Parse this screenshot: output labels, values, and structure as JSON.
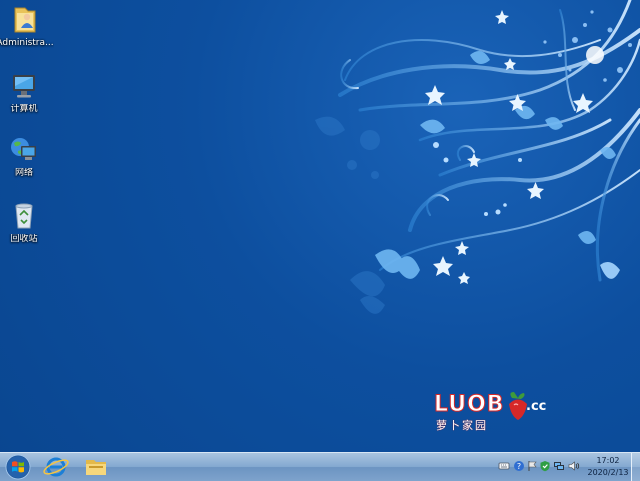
{
  "desktop": {
    "icons": [
      {
        "label": "Administra...",
        "icon": "user-folder-icon"
      },
      {
        "label": "计算机",
        "icon": "computer-icon"
      },
      {
        "label": "网络",
        "icon": "network-icon"
      },
      {
        "label": "回收站",
        "icon": "recycle-bin-icon"
      }
    ]
  },
  "wallpaper": {
    "logo_word": "LUOB",
    "logo_tld": ".cc",
    "logo_cn": "萝卜家园"
  },
  "taskbar": {
    "pinned": [
      {
        "name": "internet-explorer",
        "icon": "internet-explorer-icon"
      },
      {
        "name": "file-explorer",
        "icon": "folder-icon"
      }
    ],
    "tray": {
      "icons": [
        "keyboard-icon",
        "help-icon",
        "flag-icon",
        "shield-icon",
        "network-icon",
        "volume-icon"
      ]
    },
    "clock": {
      "time": "17:02",
      "date": "2020/2/13"
    }
  },
  "colors": {
    "desktop_blue": "#0d4f9f",
    "taskbar": "#83a8d0",
    "logo_red": "#d62828"
  }
}
